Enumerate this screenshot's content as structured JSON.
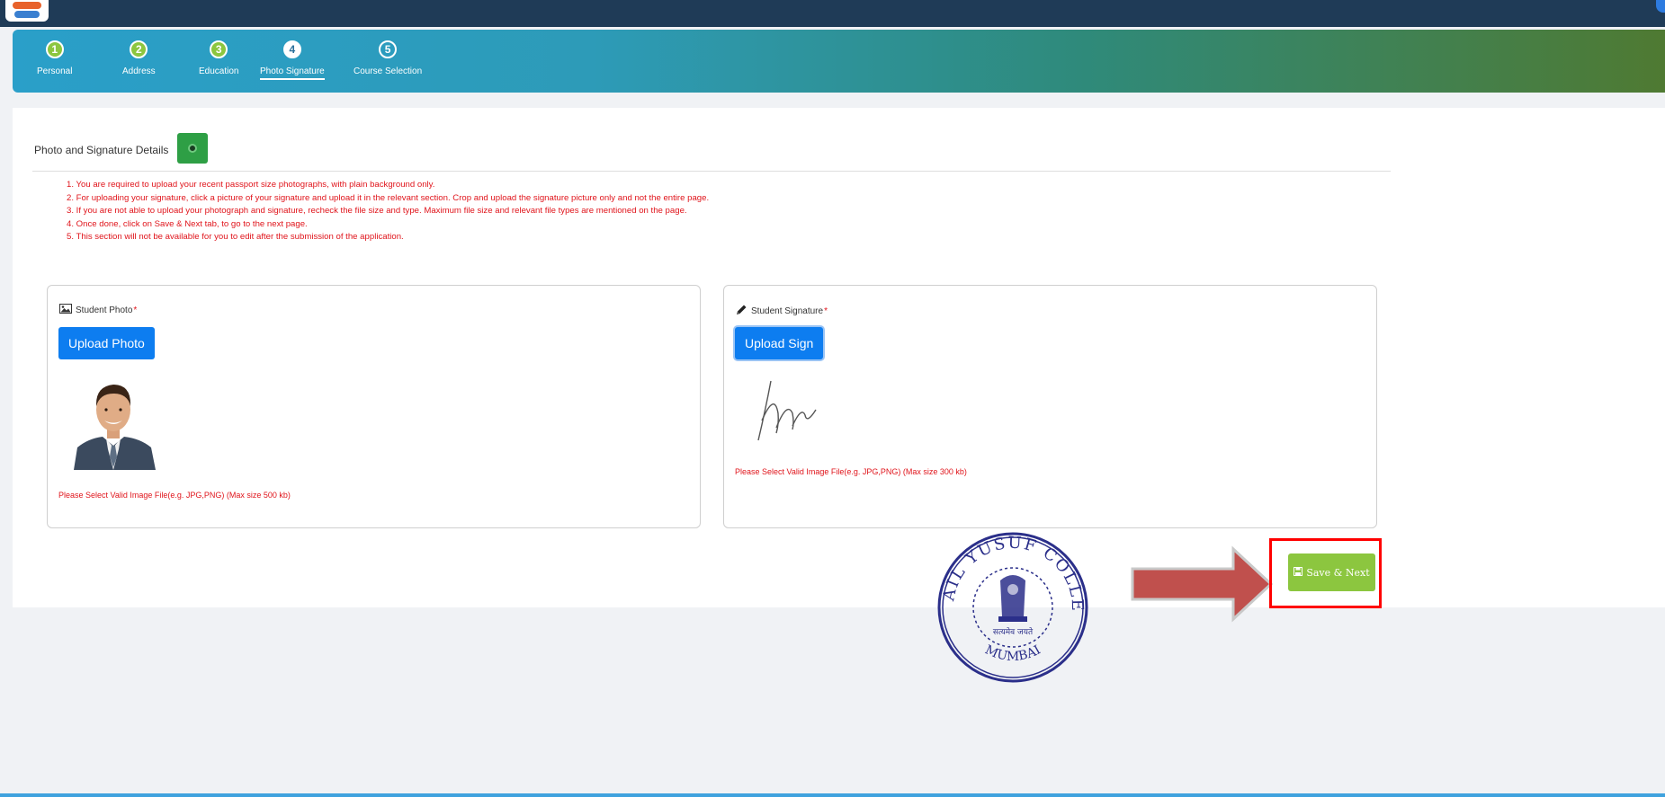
{
  "steps": [
    {
      "number": "1",
      "label": "Personal",
      "state": "done"
    },
    {
      "number": "2",
      "label": "Address",
      "state": "done"
    },
    {
      "number": "3",
      "label": "Education",
      "state": "done"
    },
    {
      "number": "4",
      "label": "Photo Signature",
      "state": "active"
    },
    {
      "number": "5",
      "label": "Course Selection",
      "state": "pending"
    }
  ],
  "section": {
    "title": "Photo and Signature Details"
  },
  "instructions": [
    "1. You are required to upload your recent passport size photographs, with plain background only.",
    "2. For uploading your signature, click a picture of your signature and upload it in the relevant section. Crop and upload the signature picture only and not the entire page.",
    "3. If you are not able to upload your photograph and signature, recheck the file size and type. Maximum file size and relevant file types are mentioned on the page.",
    "4. Once done, click on Save & Next tab, to go to the next page.",
    "5. This section will not be available for you to edit after the submission of the application."
  ],
  "photo_card": {
    "label": "Student Photo",
    "required_mark": "*",
    "button": "Upload Photo",
    "hint": "Please Select Valid Image File(e.g. JPG,PNG) (Max size 500 kb)"
  },
  "sign_card": {
    "label": "Student Signature",
    "required_mark": "*",
    "button": "Upload Sign",
    "hint": "Please Select Valid Image File(e.g. JPG,PNG) (Max size 300 kb)"
  },
  "stamp": {
    "college_name": "ISMAIL YUSUF COLLEGE",
    "city": "MUMBAI",
    "motto": "सत्यमेव जयते"
  },
  "save_button": {
    "label": "Save & Next"
  },
  "colors": {
    "header": "#1f3b57",
    "step_done": "#8cc63f",
    "upload_button": "#0d7df0",
    "save_button": "#8cc63f",
    "warning_text": "#e0141b",
    "highlight_box": "#ff0000",
    "arrow": "#c0504d",
    "stamp_ink": "#2b2f8a"
  },
  "icons": {
    "photo_icon": "image-icon",
    "sign_icon": "pencil-icon",
    "save_icon": "floppy-disk-icon",
    "toggle_icon": "collapse-toggle-icon"
  }
}
